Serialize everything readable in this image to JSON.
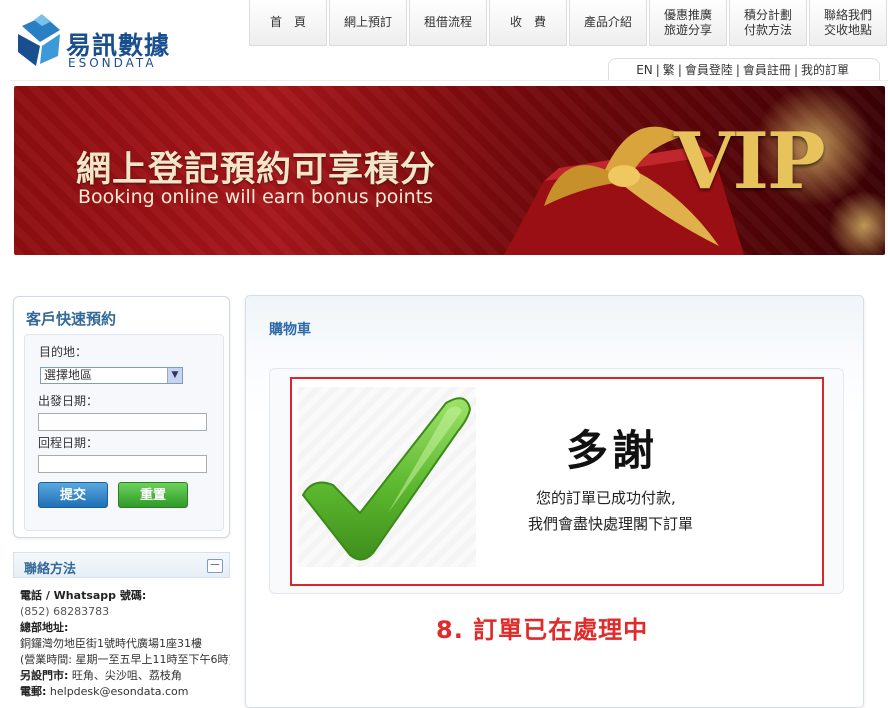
{
  "logo": {
    "name_cn": "易訊數據",
    "name_en": "ESONDATA"
  },
  "nav": [
    {
      "line1": "首　頁",
      "line2": ""
    },
    {
      "line1": "網上預訂",
      "line2": ""
    },
    {
      "line1": "租借流程",
      "line2": ""
    },
    {
      "line1": "收　費",
      "line2": ""
    },
    {
      "line1": "產品介紹",
      "line2": ""
    },
    {
      "line1": "優惠推廣",
      "line2": "旅遊分享"
    },
    {
      "line1": "積分計劃",
      "line2": "付款方法"
    },
    {
      "line1": "聯絡我們",
      "line2": "交收地點"
    }
  ],
  "util": {
    "en": "EN",
    "zh": "繁",
    "login": "會員登陸",
    "register": "會員註冊",
    "orders": "我的訂單"
  },
  "banner": {
    "title": "網上登記預約可享積分",
    "subtitle": "Booking online will earn bonus points",
    "vip": "VIP"
  },
  "quick_booking": {
    "title": "客戶快速預約",
    "destination_label": "目的地：",
    "destination_value": "選擇地區",
    "depart_label": "出發日期：",
    "return_label": "回程日期：",
    "submit_label": "提交",
    "reset_label": "重置"
  },
  "contact": {
    "title": "聯絡方法",
    "collapse_symbol": "－",
    "phone_label": "電話 / Whatsapp 號碼:",
    "phone": "(852) 68283783",
    "hq_label": "總部地址:",
    "hq_address": "銅鑼灣勿地臣街1號時代廣場1座31樓",
    "hours": "(營業時間: 星期一至五早上11時至下午6時)",
    "branches_label": "另設門市:",
    "branches": "旺角、尖沙咀、荔枝角",
    "email_label": "電郵:",
    "email": "helpdesk@esondata.com"
  },
  "cart": {
    "title": "購物車",
    "thanks": "多謝",
    "line1": "您的訂單已成功付款,",
    "line2": "我們會盡快處理閣下訂單",
    "caption": "8. 訂單已在處理中"
  },
  "colors": {
    "accent_blue": "#2f6aa8",
    "highlight_red": "#d9262c",
    "check_green": "#5cb82e"
  }
}
